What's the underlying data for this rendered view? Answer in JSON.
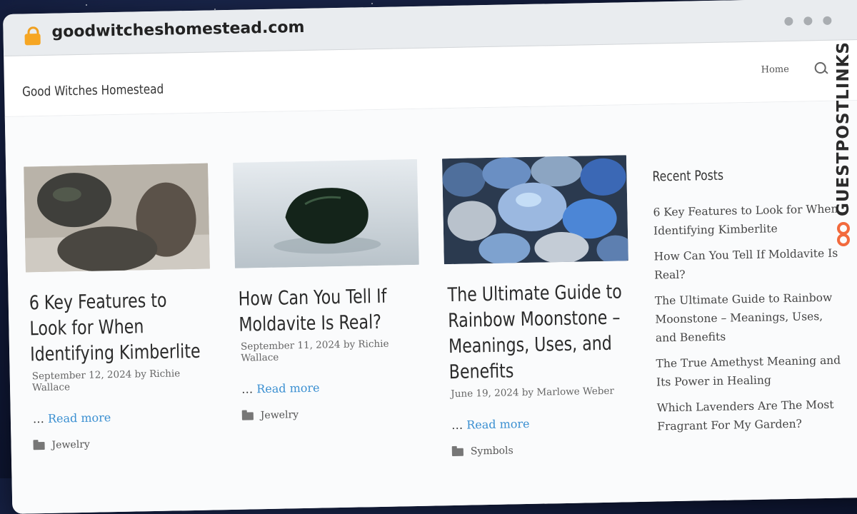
{
  "browser": {
    "url": "goodwitcheshomestead.com"
  },
  "site": {
    "title": "Good Witches Homestead",
    "nav": {
      "home": "Home"
    }
  },
  "posts": [
    {
      "title": "6 Key Features to Look for When Identifying Kimberlite",
      "date": "September 12, 2024",
      "author": "Richie Wallace",
      "excerpt_prefix": "…",
      "read_more": "Read more",
      "category": "Jewelry"
    },
    {
      "title": "How Can You Tell If Moldavite Is Real?",
      "date": "September 11, 2024",
      "author": "Richie Wallace",
      "excerpt_prefix": "…",
      "read_more": "Read more",
      "category": "Jewelry"
    },
    {
      "title": "The Ultimate Guide to Rainbow Moonstone – Meanings, Uses, and Benefits",
      "date": "June 19, 2024",
      "author": "Marlowe Weber",
      "excerpt_prefix": "…",
      "read_more": "Read more",
      "category": "Symbols"
    }
  ],
  "meta_by": "by",
  "sidebar": {
    "heading": "Recent Posts",
    "links": [
      "6 Key Features to Look for When Identifying Kimberlite",
      "How Can You Tell If Moldavite Is Real?",
      "The Ultimate Guide to Rainbow Moonstone – Meanings, Uses, and Benefits",
      "The True Amethyst Meaning and Its Power in Healing",
      "Which Lavenders Are The Most Fragrant For My Garden?"
    ]
  },
  "brand": {
    "text": "GUESTPOSTLINKS"
  },
  "colors": {
    "link": "#3a8fd1",
    "accent": "#f26a3d"
  }
}
